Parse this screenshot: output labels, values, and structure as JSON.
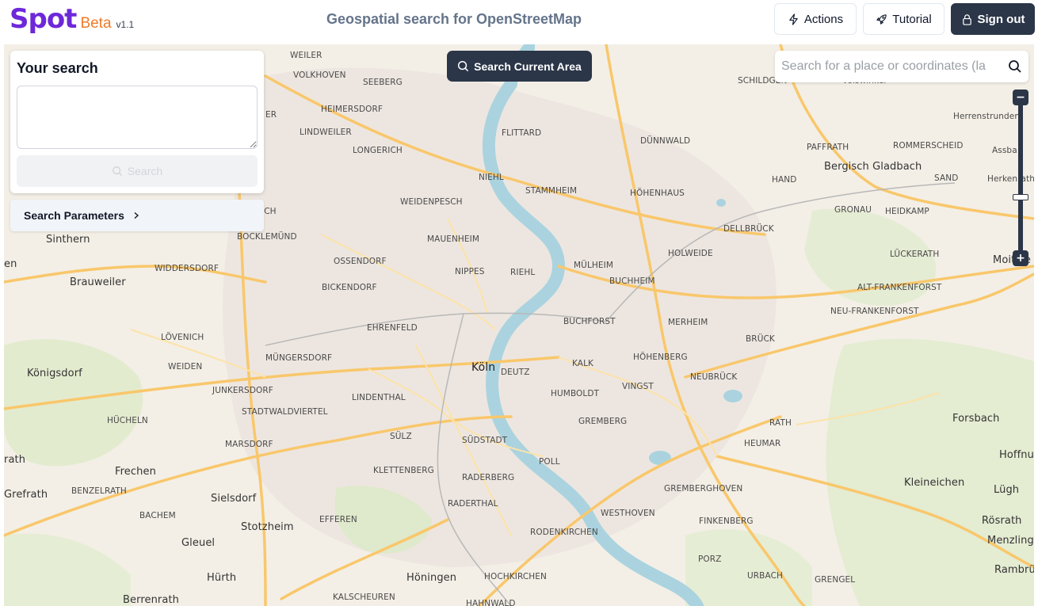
{
  "header": {
    "logo_text": "Spot",
    "beta_label": "Beta",
    "version": "v1.1",
    "title": "Geospatial search for OpenStreetMap",
    "actions_label": "Actions",
    "tutorial_label": "Tutorial",
    "signout_label": "Sign out"
  },
  "search_panel": {
    "heading": "Your search",
    "textarea_value": "",
    "search_button": "Search",
    "params_label": "Search Parameters"
  },
  "map": {
    "search_area_button": "Search Current Area",
    "search_placeholder": "Search for a place or coordinates (la",
    "zoom_in": "+",
    "zoom_out": "−",
    "places": [
      "WEILER",
      "VOLKHOVEN",
      "SEEBERG",
      "HEIMERSDORF",
      "LINDWEILER",
      "LONGERICH",
      "MERKENICH",
      "FLITTARD",
      "DÜNNWALD",
      "SCHILDGEN",
      "Voiswinkel",
      "Herrenstrunden",
      "PAFFRATH",
      "ROMMERSCHEID",
      "Bergisch Gladbach",
      "Assba",
      "Herkenrath",
      "SAND",
      "HAND",
      "GRONAU",
      "HEIDKAMP",
      "NIEHL",
      "STAMMHEIM",
      "HÖHENHAUS",
      "WEIDENPESCH",
      "DELLBRÜCK",
      "Sinthern",
      "BOCKLEMÜND",
      "MAUENHEIM",
      "LÜCKERATH",
      "Moitzfe",
      "HOLWEIDE",
      "OSSENDORF",
      "NIPPES",
      "RIEHL",
      "MÜLHEIM",
      "BUCHHEIM",
      "Brauweiler",
      "WIDDERSDORF",
      "BICKENDORF",
      "ALT-FRANKENFORST",
      "NEU-FRANKENFORST",
      "BUCHFORST",
      "MERHEIM",
      "EHRENFELD",
      "LÖVENICH",
      "MÜNGERSDORF",
      "BRÜCK",
      "HÖHENBERG",
      "KALK",
      "Köln",
      "DEUTZ",
      "Königsdorf",
      "WEIDEN",
      "NEUBRÜCK",
      "JUNKERSDORF",
      "VINGST",
      "HUMBOLDT",
      "LINDENTHAL",
      "STADTWALDVIERTEL",
      "HÜCHELN",
      "Forsbach",
      "GREMBERG",
      "RATH",
      "SÜLZ",
      "SÜDSTADT",
      "HEUMAR",
      "MARSDORF",
      "Hoffnung",
      "rath",
      "Frechen",
      "POLL",
      "KLETTENBERG",
      "RADERBERG",
      "Kleineichen",
      "Grefrath",
      "BENZELRATH",
      "Sielsdorf",
      "GREMBERGHOVEN",
      "Lügh",
      "RADERTHAL",
      "BACHEM",
      "EFFEREN",
      "WESTHOVEN",
      "FINKENBERG",
      "Rösrath",
      "Stotzheim",
      "RODENKIRCHEN",
      "Gleuel",
      "Menzlinge",
      "PORZ",
      "Hürth",
      "Höningen",
      "HOCHKIRCHEN",
      "URBACH",
      "GRENGEL",
      "Rambrüc",
      "Berrenrath",
      "KALSCHEUREN",
      "HAHNWALD",
      "en",
      "ICH",
      "ER"
    ]
  },
  "colors": {
    "brand_purple": "#6d28d9",
    "beta_orange": "#f07a2a",
    "dark_button": "#2b3648",
    "river": "#aad3df",
    "major_road": "#f9c76b"
  }
}
